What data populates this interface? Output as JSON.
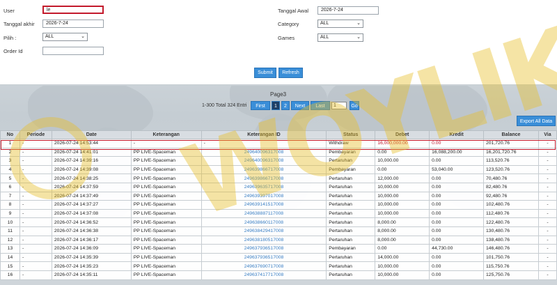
{
  "filters": {
    "user_label": "User",
    "user_value": "le",
    "tanggal_awal_label": "Tanggal Awal",
    "tanggal_awal_value": "2026-7-24",
    "tanggal_akhir_label": "Tanggal akhir",
    "tanggal_akhir_value": "2026-7-24",
    "category_label": "Category",
    "category_value": "ALL",
    "pilih_label": "Pilih :",
    "pilih_value": "ALL",
    "games_label": "Games",
    "games_value": "ALL",
    "order_id_label": "Order Id",
    "order_id_value": "",
    "submit_label": "Submit",
    "refresh_label": "Refresh"
  },
  "pager": {
    "title": "Page3",
    "info": "1-300 Total 324 Entri",
    "first": "First",
    "p1": "1",
    "p2": "2",
    "next": "Next",
    "last": "Last",
    "input_value": "1",
    "go": "Go"
  },
  "export_label": "Export All Data",
  "table": {
    "headers": [
      "No",
      "Periode",
      "Date",
      "Keterangan",
      "Keterangan ID",
      "Status",
      "Debet",
      "Kredit",
      "Balance",
      "Via"
    ],
    "rows": [
      [
        "1",
        "-",
        "2026-07-24 14:53:44",
        "-",
        "-",
        "Withdraw",
        "16,000,000.00",
        "0.00",
        "201,720.76",
        "-"
      ],
      [
        "2",
        "-",
        "2026-07-24 14:41:01",
        "PP LIVE-Spaceman",
        "249640096317008",
        "Pembayaran",
        "0.00",
        "16,088,200.00",
        "16,201,720.76",
        "-"
      ],
      [
        "3",
        "-",
        "2026-07-24 14:39:16",
        "PP LIVE-Spaceman",
        "249640096317008",
        "Pertaruhan",
        "10,000.00",
        "0.00",
        "113,520.76",
        "-"
      ],
      [
        "4",
        "-",
        "2026-07-24 14:39:08",
        "PP LIVE-Spaceman",
        "249639866717008",
        "Pembayaran",
        "0.00",
        "53,040.00",
        "123,520.76",
        "-"
      ],
      [
        "5",
        "-",
        "2026-07-24 14:38:25",
        "PP LIVE-Spaceman",
        "249639866717008",
        "Pertaruhan",
        "12,000.00",
        "0.00",
        "70,480.76",
        "-"
      ],
      [
        "6",
        "-",
        "2026-07-24 14:37:59",
        "PP LIVE-Spaceman",
        "249639635717008",
        "Pertaruhan",
        "10,000.00",
        "0.00",
        "82,480.76",
        "-"
      ],
      [
        "7",
        "-",
        "2026-07-24 14:37:49",
        "PP LIVE-Spaceman",
        "249639397017008",
        "Pertaruhan",
        "10,000.00",
        "0.00",
        "92,480.76",
        "-"
      ],
      [
        "8",
        "-",
        "2026-07-24 14:37:27",
        "PP LIVE-Spaceman",
        "249639141517008",
        "Pertaruhan",
        "10,000.00",
        "0.00",
        "102,480.76",
        "-"
      ],
      [
        "9",
        "-",
        "2026-07-24 14:37:08",
        "PP LIVE-Spaceman",
        "249638887117008",
        "Pertaruhan",
        "10,000.00",
        "0.00",
        "112,480.76",
        "-"
      ],
      [
        "10",
        "-",
        "2026-07-24 14:36:52",
        "PP LIVE-Spaceman",
        "249638660117008",
        "Pertaruhan",
        "8,000.00",
        "0.00",
        "122,480.76",
        "-"
      ],
      [
        "11",
        "-",
        "2026-07-24 14:36:38",
        "PP LIVE-Spaceman",
        "249638429417008",
        "Pertaruhan",
        "8,000.00",
        "0.00",
        "130,480.76",
        "-"
      ],
      [
        "12",
        "-",
        "2026-07-24 14:36:17",
        "PP LIVE-Spaceman",
        "249638180517008",
        "Pertaruhan",
        "8,000.00",
        "0.00",
        "138,480.76",
        "-"
      ],
      [
        "13",
        "-",
        "2026-07-24 14:36:09",
        "PP LIVE-Spaceman",
        "249637936517008",
        "Pembayaran",
        "0.00",
        "44,730.00",
        "146,480.76",
        "-"
      ],
      [
        "14",
        "-",
        "2026-07-24 14:35:39",
        "PP LIVE-Spaceman",
        "249637936517008",
        "Pertaruhan",
        "14,000.00",
        "0.00",
        "101,750.76",
        "-"
      ],
      [
        "15",
        "-",
        "2026-07-24 14:35:23",
        "PP LIVE-Spaceman",
        "249637690717008",
        "Pertaruhan",
        "10,000.00",
        "0.00",
        "115,750.76",
        "-"
      ],
      [
        "16",
        "-",
        "2026-07-24 14:35:11",
        "PP LIVE-Spaceman",
        "249637417717008",
        "Pertaruhan",
        "10,000.00",
        "0.00",
        "125,750.76",
        "-"
      ]
    ]
  },
  "watermark": "WOYLIK",
  "colors": {
    "accent": "#3a8ed8",
    "highlight": "#c3192b",
    "link": "#3a7fc4"
  }
}
